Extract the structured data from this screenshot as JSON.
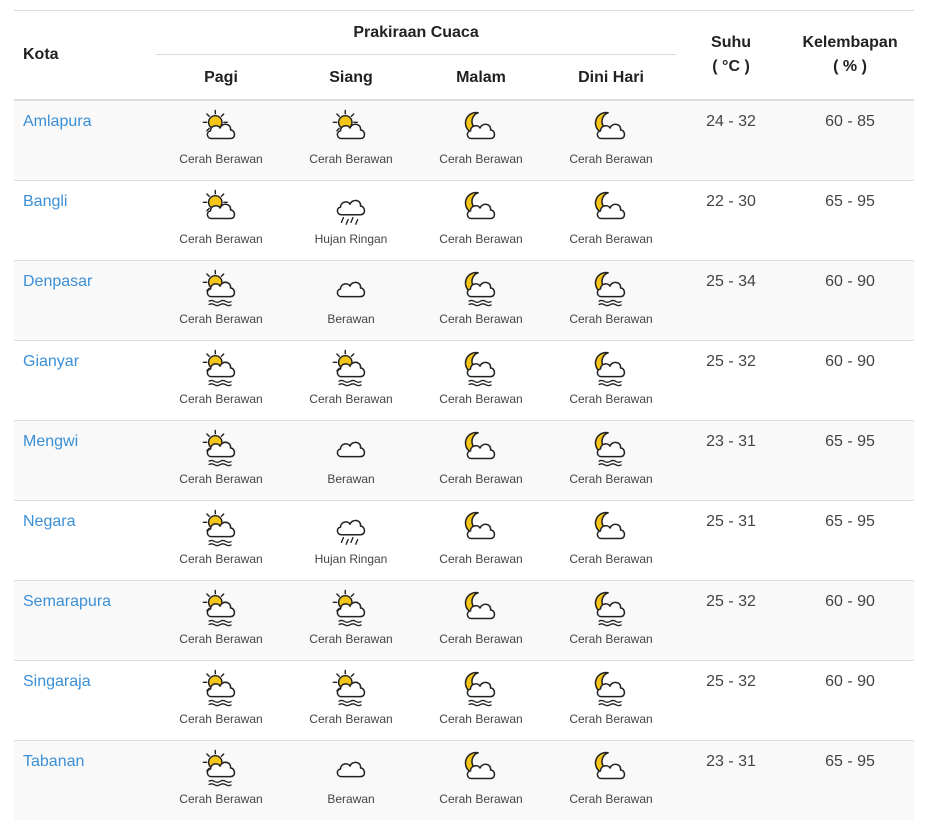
{
  "header": {
    "kota": "Kota",
    "group": "Prakiraan Cuaca",
    "periods": [
      "Pagi",
      "Siang",
      "Malam",
      "Dini Hari"
    ],
    "suhu": "Suhu",
    "suhu_unit": "( °C )",
    "kelembapan": "Kelembapan",
    "kelembapan_unit": "( % )"
  },
  "rows": [
    {
      "city": "Amlapura",
      "forecast": [
        {
          "icon": "sun-cloud-icon",
          "label": "Cerah Berawan"
        },
        {
          "icon": "sun-cloud-icon",
          "label": "Cerah Berawan"
        },
        {
          "icon": "moon-cloud-icon",
          "label": "Cerah Berawan"
        },
        {
          "icon": "moon-cloud-icon",
          "label": "Cerah Berawan"
        }
      ],
      "suhu": "24 - 32",
      "kelembapan": "60 - 85"
    },
    {
      "city": "Bangli",
      "forecast": [
        {
          "icon": "sun-cloud-icon",
          "label": "Cerah Berawan"
        },
        {
          "icon": "rain-cloud-icon",
          "label": "Hujan Ringan"
        },
        {
          "icon": "moon-cloud-icon",
          "label": "Cerah Berawan"
        },
        {
          "icon": "moon-cloud-icon",
          "label": "Cerah Berawan"
        }
      ],
      "suhu": "22 - 30",
      "kelembapan": "65 - 95"
    },
    {
      "city": "Denpasar",
      "forecast": [
        {
          "icon": "sun-cloud-haze-icon",
          "label": "Cerah Berawan"
        },
        {
          "icon": "cloud-icon",
          "label": "Berawan"
        },
        {
          "icon": "moon-cloud-haze-icon",
          "label": "Cerah Berawan"
        },
        {
          "icon": "moon-cloud-haze-icon",
          "label": "Cerah Berawan"
        }
      ],
      "suhu": "25 - 34",
      "kelembapan": "60 - 90"
    },
    {
      "city": "Gianyar",
      "forecast": [
        {
          "icon": "sun-cloud-haze-icon",
          "label": "Cerah Berawan"
        },
        {
          "icon": "sun-cloud-haze-icon",
          "label": "Cerah Berawan"
        },
        {
          "icon": "moon-cloud-haze-icon",
          "label": "Cerah Berawan"
        },
        {
          "icon": "moon-cloud-haze-icon",
          "label": "Cerah Berawan"
        }
      ],
      "suhu": "25 - 32",
      "kelembapan": "60 - 90"
    },
    {
      "city": "Mengwi",
      "forecast": [
        {
          "icon": "sun-cloud-haze-icon",
          "label": "Cerah Berawan"
        },
        {
          "icon": "cloud-icon",
          "label": "Berawan"
        },
        {
          "icon": "moon-cloud-icon",
          "label": "Cerah Berawan"
        },
        {
          "icon": "moon-cloud-haze-icon",
          "label": "Cerah Berawan"
        }
      ],
      "suhu": "23 - 31",
      "kelembapan": "65 - 95"
    },
    {
      "city": "Negara",
      "forecast": [
        {
          "icon": "sun-cloud-haze-icon",
          "label": "Cerah Berawan"
        },
        {
          "icon": "rain-cloud-icon",
          "label": "Hujan Ringan"
        },
        {
          "icon": "moon-cloud-icon",
          "label": "Cerah Berawan"
        },
        {
          "icon": "moon-cloud-icon",
          "label": "Cerah Berawan"
        }
      ],
      "suhu": "25 - 31",
      "kelembapan": "65 - 95"
    },
    {
      "city": "Semarapura",
      "forecast": [
        {
          "icon": "sun-cloud-haze-icon",
          "label": "Cerah Berawan"
        },
        {
          "icon": "sun-cloud-haze-icon",
          "label": "Cerah Berawan"
        },
        {
          "icon": "moon-cloud-icon",
          "label": "Cerah Berawan"
        },
        {
          "icon": "moon-cloud-haze-icon",
          "label": "Cerah Berawan"
        }
      ],
      "suhu": "25 - 32",
      "kelembapan": "60 - 90"
    },
    {
      "city": "Singaraja",
      "forecast": [
        {
          "icon": "sun-cloud-haze-icon",
          "label": "Cerah Berawan"
        },
        {
          "icon": "sun-cloud-haze-icon",
          "label": "Cerah Berawan"
        },
        {
          "icon": "moon-cloud-haze-icon",
          "label": "Cerah Berawan"
        },
        {
          "icon": "moon-cloud-haze-icon",
          "label": "Cerah Berawan"
        }
      ],
      "suhu": "25 - 32",
      "kelembapan": "60 - 90"
    },
    {
      "city": "Tabanan",
      "forecast": [
        {
          "icon": "sun-cloud-haze-icon",
          "label": "Cerah Berawan"
        },
        {
          "icon": "cloud-icon",
          "label": "Berawan"
        },
        {
          "icon": "moon-cloud-icon",
          "label": "Cerah Berawan"
        },
        {
          "icon": "moon-cloud-icon",
          "label": "Cerah Berawan"
        }
      ],
      "suhu": "23 - 31",
      "kelembapan": "65 - 95"
    }
  ],
  "colors": {
    "link": "#3a8fd6",
    "sun": "#f5c518",
    "stripe": "#f9f9f9",
    "border": "#dddddd"
  }
}
